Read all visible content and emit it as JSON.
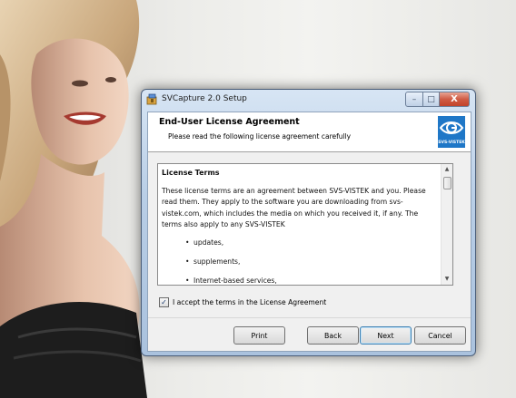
{
  "window": {
    "title": "SVCapture 2.0 Setup",
    "controls": {
      "minimize": "–",
      "maximize": "□",
      "close": "X"
    }
  },
  "banner": {
    "title": "End-User License Agreement",
    "subtitle": "Please read the following license agreement carefully",
    "logo_text": "SVS-VISTEK"
  },
  "license": {
    "heading": "License Terms",
    "paragraph": "These license terms are an agreement between SVS-VISTEK and you. Please read them. They apply to the software you are downloading from svs-vistek.com, which includes the media on which you received it, if any. The terms also apply to any SVS-VISTEK",
    "bullets": [
      "updates,",
      "supplements,",
      "Internet-based services,"
    ]
  },
  "accept": {
    "label": "I accept the terms in the License Agreement",
    "checked": true,
    "check_glyph": "✓"
  },
  "buttons": {
    "print": "Print",
    "back": "Back",
    "next": "Next",
    "cancel": "Cancel"
  },
  "colors": {
    "logo_blue": "#1f77c7",
    "close_red": "#c2432b",
    "dialog_frame": "#b9cee6"
  },
  "icons": {
    "app": "installer-package-icon",
    "scroll_up": "▲",
    "scroll_down": "▼"
  }
}
